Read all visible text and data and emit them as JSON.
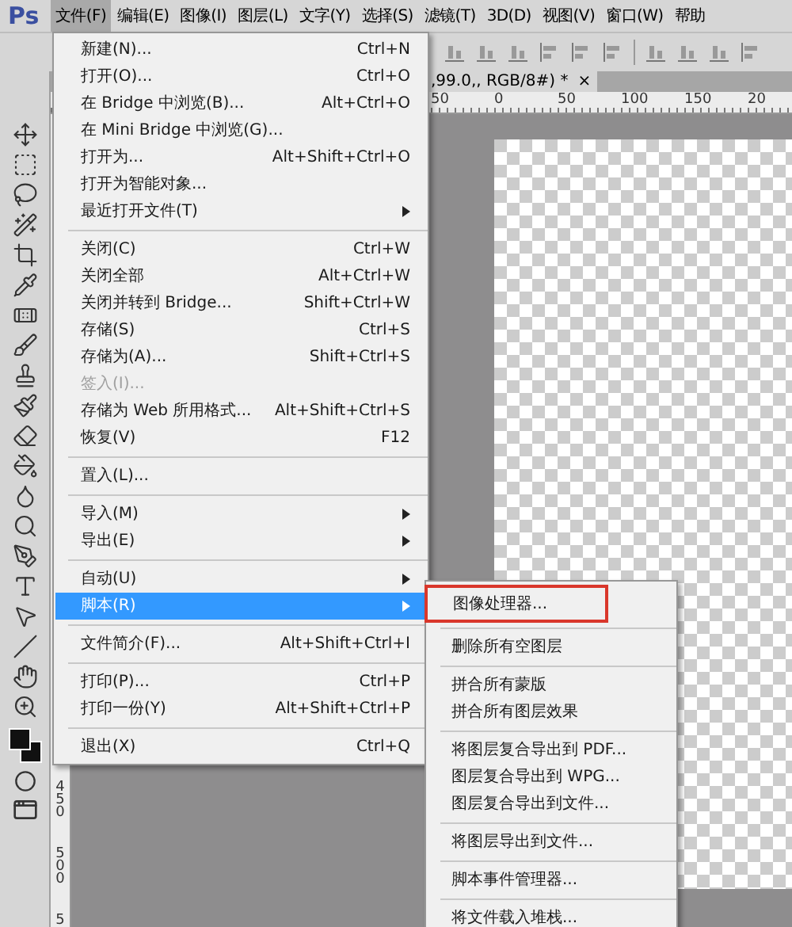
{
  "app": {
    "logo": "Ps"
  },
  "menubar": [
    {
      "label": "文件(F)",
      "selected": true
    },
    {
      "label": "编辑(E)",
      "selected": false
    },
    {
      "label": "图像(I)",
      "selected": false
    },
    {
      "label": "图层(L)",
      "selected": false
    },
    {
      "label": "文字(Y)",
      "selected": false
    },
    {
      "label": "选择(S)",
      "selected": false
    },
    {
      "label": "滤镜(T)",
      "selected": false
    },
    {
      "label": "3D(D)",
      "selected": false
    },
    {
      "label": "视图(V)",
      "selected": false
    },
    {
      "label": "窗口(W)",
      "selected": false
    },
    {
      "label": "帮助",
      "selected": false
    }
  ],
  "document_tab": {
    "title": ",99.0,, RGB/8#) *",
    "close": "×"
  },
  "top_ruler": [
    "50",
    "0",
    "50",
    "100",
    "150",
    "20"
  ],
  "left_ruler": [
    "450",
    "500",
    "5"
  ],
  "file_menu": [
    [
      {
        "label": "新建(N)...",
        "shortcut": "Ctrl+N",
        "kind": "command",
        "disabled": false,
        "selected": false
      },
      {
        "label": "打开(O)...",
        "shortcut": "Ctrl+O",
        "kind": "command",
        "disabled": false,
        "selected": false
      },
      {
        "label": "在 Bridge 中浏览(B)...",
        "shortcut": "Alt+Ctrl+O",
        "kind": "command",
        "disabled": false,
        "selected": false
      },
      {
        "label": "在 Mini Bridge 中浏览(G)...",
        "kind": "command",
        "disabled": false,
        "selected": false
      },
      {
        "label": "打开为...",
        "shortcut": "Alt+Shift+Ctrl+O",
        "kind": "command",
        "disabled": false,
        "selected": false
      },
      {
        "label": "打开为智能对象...",
        "kind": "command",
        "disabled": false,
        "selected": false
      },
      {
        "label": "最近打开文件(T)",
        "kind": "submenu",
        "disabled": false,
        "selected": false
      }
    ],
    [
      {
        "label": "关闭(C)",
        "shortcut": "Ctrl+W",
        "kind": "command",
        "disabled": false,
        "selected": false
      },
      {
        "label": "关闭全部",
        "shortcut": "Alt+Ctrl+W",
        "kind": "command",
        "disabled": false,
        "selected": false
      },
      {
        "label": "关闭并转到 Bridge...",
        "shortcut": "Shift+Ctrl+W",
        "kind": "command",
        "disabled": false,
        "selected": false
      },
      {
        "label": "存储(S)",
        "shortcut": "Ctrl+S",
        "kind": "command",
        "disabled": false,
        "selected": false
      },
      {
        "label": "存储为(A)...",
        "shortcut": "Shift+Ctrl+S",
        "kind": "command",
        "disabled": false,
        "selected": false
      },
      {
        "label": "签入(I)...",
        "kind": "command",
        "disabled": true,
        "selected": false
      },
      {
        "label": "存储为 Web 所用格式...",
        "shortcut": "Alt+Shift+Ctrl+S",
        "kind": "command",
        "disabled": false,
        "selected": false
      },
      {
        "label": "恢复(V)",
        "shortcut": "F12",
        "kind": "command",
        "disabled": false,
        "selected": false
      }
    ],
    [
      {
        "label": "置入(L)...",
        "kind": "command",
        "disabled": false,
        "selected": false
      }
    ],
    [
      {
        "label": "导入(M)",
        "kind": "submenu",
        "disabled": false,
        "selected": false
      },
      {
        "label": "导出(E)",
        "kind": "submenu",
        "disabled": false,
        "selected": false
      }
    ],
    [
      {
        "label": "自动(U)",
        "kind": "submenu",
        "disabled": false,
        "selected": false
      },
      {
        "label": "脚本(R)",
        "kind": "submenu",
        "disabled": false,
        "selected": true
      }
    ],
    [
      {
        "label": "文件简介(F)...",
        "shortcut": "Alt+Shift+Ctrl+I",
        "kind": "command",
        "disabled": false,
        "selected": false
      }
    ],
    [
      {
        "label": "打印(P)...",
        "shortcut": "Ctrl+P",
        "kind": "command",
        "disabled": false,
        "selected": false
      },
      {
        "label": "打印一份(Y)",
        "shortcut": "Alt+Shift+Ctrl+P",
        "kind": "command",
        "disabled": false,
        "selected": false
      }
    ],
    [
      {
        "label": "退出(X)",
        "shortcut": "Ctrl+Q",
        "kind": "command",
        "disabled": false,
        "selected": false
      }
    ]
  ],
  "scripts_submenu": [
    [
      {
        "label": "图像处理器...",
        "highlighted": true
      }
    ],
    [
      {
        "label": "删除所有空图层",
        "highlighted": false
      }
    ],
    [
      {
        "label": "拼合所有蒙版",
        "highlighted": false
      },
      {
        "label": "拼合所有图层效果",
        "highlighted": false
      }
    ],
    [
      {
        "label": "将图层复合导出到 PDF...",
        "highlighted": false
      },
      {
        "label": "图层复合导出到 WPG...",
        "highlighted": false
      },
      {
        "label": "图层复合导出到文件...",
        "highlighted": false
      }
    ],
    [
      {
        "label": "将图层导出到文件...",
        "highlighted": false
      }
    ],
    [
      {
        "label": "脚本事件管理器...",
        "highlighted": false
      }
    ],
    [
      {
        "label": "将文件载入堆栈...",
        "highlighted": false
      }
    ]
  ]
}
